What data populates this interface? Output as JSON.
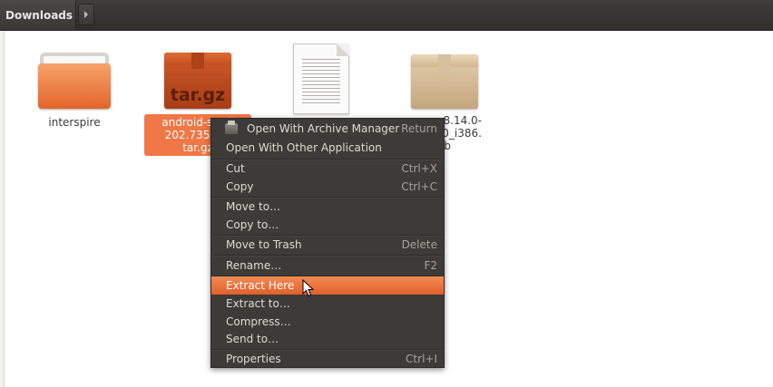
{
  "location": {
    "breadcrumb": "Downloads"
  },
  "files": [
    {
      "name": "interspire",
      "icon": "folder-icon",
      "selected": false
    },
    {
      "name_lines": [
        "android-studi",
        "202.735108",
        "tar.gz"
      ],
      "icon_text": "tar.gz",
      "icon": "archive-icon",
      "selected": true
    },
    {
      "name_lines": [
        "",
        ""
      ],
      "icon": "text-document-icon",
      "selected": false
    },
    {
      "name_lines": [
        "-8.14.0-",
        "110_i386.",
        "eb"
      ],
      "icon": "package-icon",
      "selected": false
    }
  ],
  "context_menu": {
    "items": [
      {
        "label": "Open With Archive Manager",
        "shortcut": "Return",
        "icon": "archive-manager-icon"
      },
      {
        "label": "Open With Other Application",
        "shortcut": ""
      },
      {
        "label": "Cut",
        "shortcut": "Ctrl+X"
      },
      {
        "label": "Copy",
        "shortcut": "Ctrl+C"
      },
      {
        "label": "Move to…",
        "shortcut": ""
      },
      {
        "label": "Copy to…",
        "shortcut": ""
      },
      {
        "label": "Move to Trash",
        "shortcut": "Delete"
      },
      {
        "label": "Rename…",
        "shortcut": "F2"
      },
      {
        "label": "Extract Here",
        "shortcut": "",
        "highlighted": true
      },
      {
        "label": "Extract to…",
        "shortcut": ""
      },
      {
        "label": "Compress…",
        "shortcut": ""
      },
      {
        "label": "Send to…",
        "shortcut": ""
      },
      {
        "label": "Properties",
        "shortcut": "Ctrl+I"
      }
    ]
  },
  "colors": {
    "accent": "#f07746",
    "menu_bg": "#3c3b37",
    "topbar": "#3a3935"
  }
}
